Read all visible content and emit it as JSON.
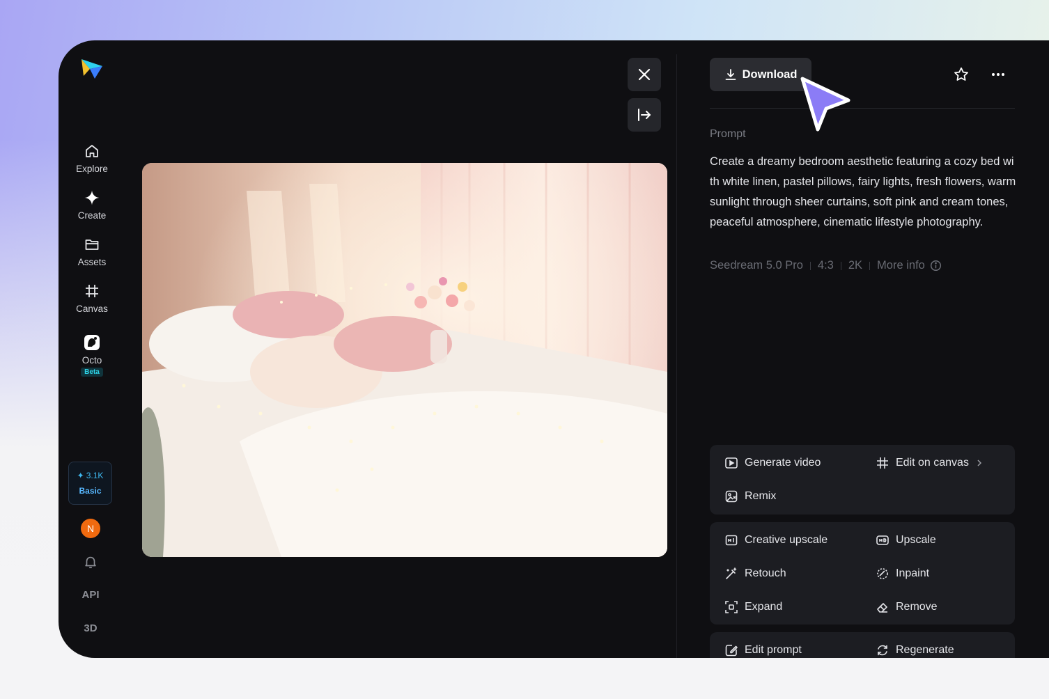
{
  "sidebar": {
    "logo": "app-logo",
    "items": [
      {
        "label": "Explore",
        "icon": "home-icon"
      },
      {
        "label": "Create",
        "icon": "sparkle-icon"
      },
      {
        "label": "Assets",
        "icon": "folder-icon"
      },
      {
        "label": "Canvas",
        "icon": "crop-grid-icon"
      },
      {
        "label": "Octo",
        "icon": "octo-icon",
        "badge": "Beta"
      }
    ],
    "credits": {
      "amount": "3.1K",
      "plan": "Basic"
    },
    "avatar_initial": "N",
    "api_label": "API",
    "threed_label": "3D"
  },
  "viewer": {
    "close_icon": "close-icon",
    "collapse_icon": "collapse-panel-icon",
    "image_alt": "Dreamy bedroom with white linen, pastel pillows, fairy lights and flowers"
  },
  "panel": {
    "download_label": "Download",
    "prompt_label": "Prompt",
    "prompt_text": "Create a dreamy bedroom aesthetic featuring a cozy bed with white linen, pastel pillows, fairy lights, fresh flowers, warm sunlight through sheer curtains, soft pink and cream tones, peaceful atmosphere, cinematic lifestyle photography.",
    "meta": {
      "model": "Seedream 5.0 Pro",
      "ratio": "4:3",
      "resolution": "2K",
      "more_info": "More info"
    },
    "actions_group1": {
      "generate_video": "Generate video",
      "edit_on_canvas": "Edit on canvas",
      "remix": "Remix"
    },
    "actions_group2": {
      "creative_upscale": "Creative upscale",
      "upscale": "Upscale",
      "retouch": "Retouch",
      "inpaint": "Inpaint",
      "expand": "Expand",
      "remove": "Remove"
    },
    "actions_group3": {
      "edit_prompt": "Edit prompt",
      "regenerate": "Regenerate"
    }
  },
  "colors": {
    "accent": "#8b7cf6",
    "background": "#0f0f12",
    "card": "#1c1d22"
  }
}
